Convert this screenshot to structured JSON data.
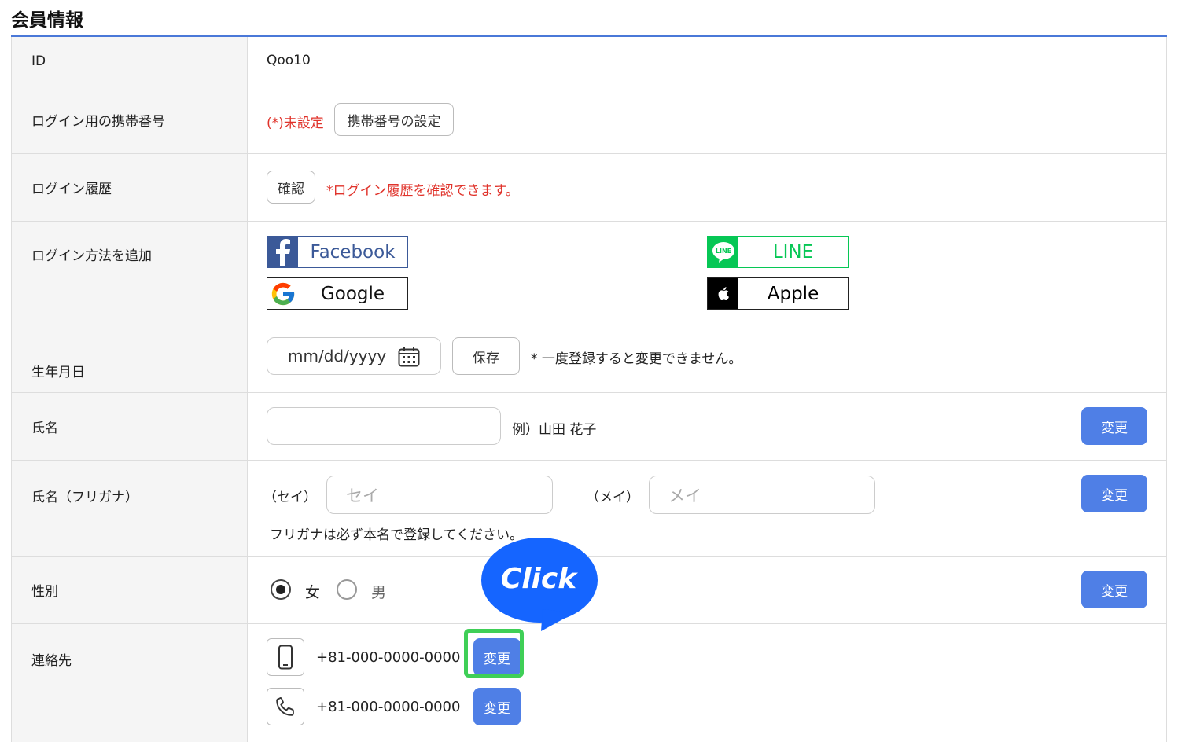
{
  "page": {
    "title": "会員情報"
  },
  "rows": {
    "id": {
      "label": "ID",
      "value": "Qoo10"
    },
    "login_phone": {
      "label": "ログイン用の携帯番号",
      "status": "(*)未設定",
      "button": "携帯番号の設定"
    },
    "login_history": {
      "label": "ログイン履歴",
      "button": "確認",
      "note": "*ログイン履歴を確認できます。"
    },
    "login_methods": {
      "label": "ログイン方法を追加",
      "facebook": "Facebook",
      "line": "LINE",
      "google": "Google",
      "apple": "Apple",
      "line_icon_text": "LINE"
    },
    "birthday": {
      "label": "生年月日",
      "placeholder": "mm/dd/yyyy",
      "button": "保存",
      "note": "* 一度登録すると変更できません。"
    },
    "name": {
      "label": "氏名",
      "example": "例）山田 花子",
      "button": "変更"
    },
    "kana": {
      "label": "氏名（フリガナ）",
      "sei_label": "（セイ）",
      "sei_placeholder": "セイ",
      "mei_label": "（メイ）",
      "mei_placeholder": "メイ",
      "note": "フリガナは必ず本名で登録してください。",
      "button": "変更"
    },
    "gender": {
      "label": "性別",
      "female": "女",
      "male": "男",
      "selected": "女",
      "button": "変更"
    },
    "contact": {
      "label": "連絡先",
      "mobile": "+81-000-0000-0000",
      "mobile_button": "変更",
      "phone": "+81-000-0000-0000",
      "phone_button": "変更"
    }
  },
  "callout": {
    "text": "Click"
  },
  "colors": {
    "accent": "#4a78d8",
    "button_blue": "#4f7fe6",
    "alert_red": "#e0332b",
    "facebook": "#3b5998",
    "line": "#06c755",
    "highlight_green": "#3fcf57",
    "callout_blue": "#1565ff"
  }
}
